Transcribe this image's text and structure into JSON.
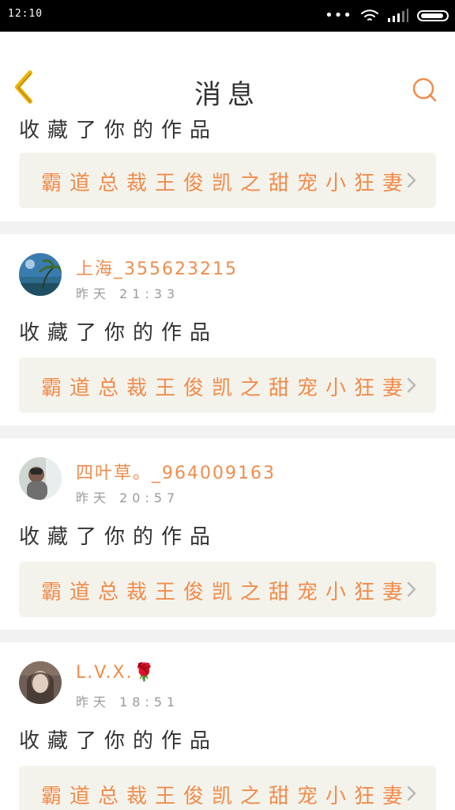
{
  "status": {
    "time": "12:10"
  },
  "header": {
    "title": "消息"
  },
  "items": [
    {
      "action": "收藏了你的作品",
      "work_title": "霸道总裁王俊凯之甜宠小狂妻"
    },
    {
      "name": "上海_355623215",
      "time": "昨天 21:33",
      "action": "收藏了你的作品",
      "work_title": "霸道总裁王俊凯之甜宠小狂妻"
    },
    {
      "name": "四叶草。_964009163",
      "time": "昨天 20:57",
      "action": "收藏了你的作品",
      "work_title": "霸道总裁王俊凯之甜宠小狂妻"
    },
    {
      "name": "L.V.X.🌹",
      "time": "昨天 18:51",
      "action": "收藏了你的作品",
      "work_title": "霸道总裁王俊凯之甜宠小狂妻"
    }
  ],
  "colors": {
    "accent": "#f08c4c",
    "back_icon": "#f0b400",
    "text": "#333333",
    "meta": "#9a9a9a",
    "card_bg": "#f3f3ec"
  },
  "icons": {
    "back": "chevron-left-icon",
    "search": "search-icon",
    "item_arrow": "chevron-right-icon"
  }
}
